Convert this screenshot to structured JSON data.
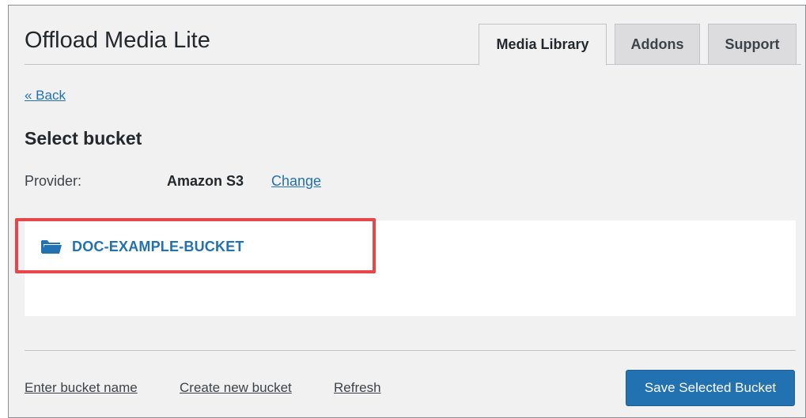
{
  "app": {
    "title": "Offload Media Lite"
  },
  "tabs": [
    {
      "label": "Media Library",
      "active": true
    },
    {
      "label": "Addons",
      "active": false
    },
    {
      "label": "Support",
      "active": false
    }
  ],
  "nav": {
    "back_label": "« Back"
  },
  "section": {
    "title": "Select bucket"
  },
  "provider": {
    "label": "Provider:",
    "value": "Amazon S3",
    "change_label": "Change"
  },
  "buckets": [
    {
      "name": "DOC-EXAMPLE-BUCKET",
      "icon": "folder-open-icon"
    }
  ],
  "footer": {
    "enter_bucket_label": "Enter bucket name",
    "create_bucket_label": "Create new bucket",
    "refresh_label": "Refresh",
    "save_label": "Save Selected Bucket"
  },
  "colors": {
    "accent": "#2271b1",
    "highlight": "#e8474a",
    "background": "#f1f1f1"
  }
}
